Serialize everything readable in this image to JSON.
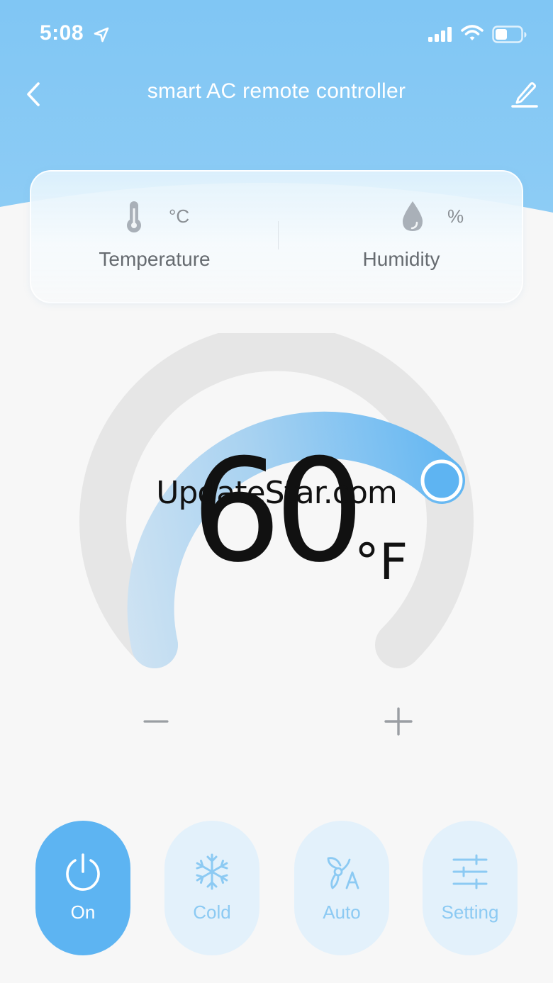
{
  "colors": {
    "header": "#7cc4f4",
    "accent": "#5db4f2",
    "button_inactive": "#e3f1fb",
    "text_dark": "#111111"
  },
  "status_bar": {
    "time": "5:08",
    "icons": [
      "location-arrow-icon",
      "cellular-signal-icon",
      "wifi-icon",
      "battery-icon"
    ]
  },
  "header": {
    "title": "smart AC remote controller",
    "back_icon": "chevron-left-icon",
    "edit_icon": "pencil-icon"
  },
  "sensors": {
    "temperature": {
      "unit": "°C",
      "label": "Temperature",
      "icon": "thermometer-icon"
    },
    "humidity": {
      "unit": "%",
      "label": "Humidity",
      "icon": "water-drop-icon"
    }
  },
  "thermostat": {
    "value": "60",
    "unit": "°F",
    "watermark": "UpdateStar.com",
    "decrease_icon": "minus-icon",
    "increase_icon": "plus-icon"
  },
  "controls": [
    {
      "label": "On",
      "icon": "power-icon",
      "active": true
    },
    {
      "label": "Cold",
      "icon": "snowflake-icon",
      "active": false
    },
    {
      "label": "Auto",
      "icon": "fan-auto-icon",
      "active": false
    },
    {
      "label": "Setting",
      "icon": "sliders-icon",
      "active": false
    }
  ]
}
